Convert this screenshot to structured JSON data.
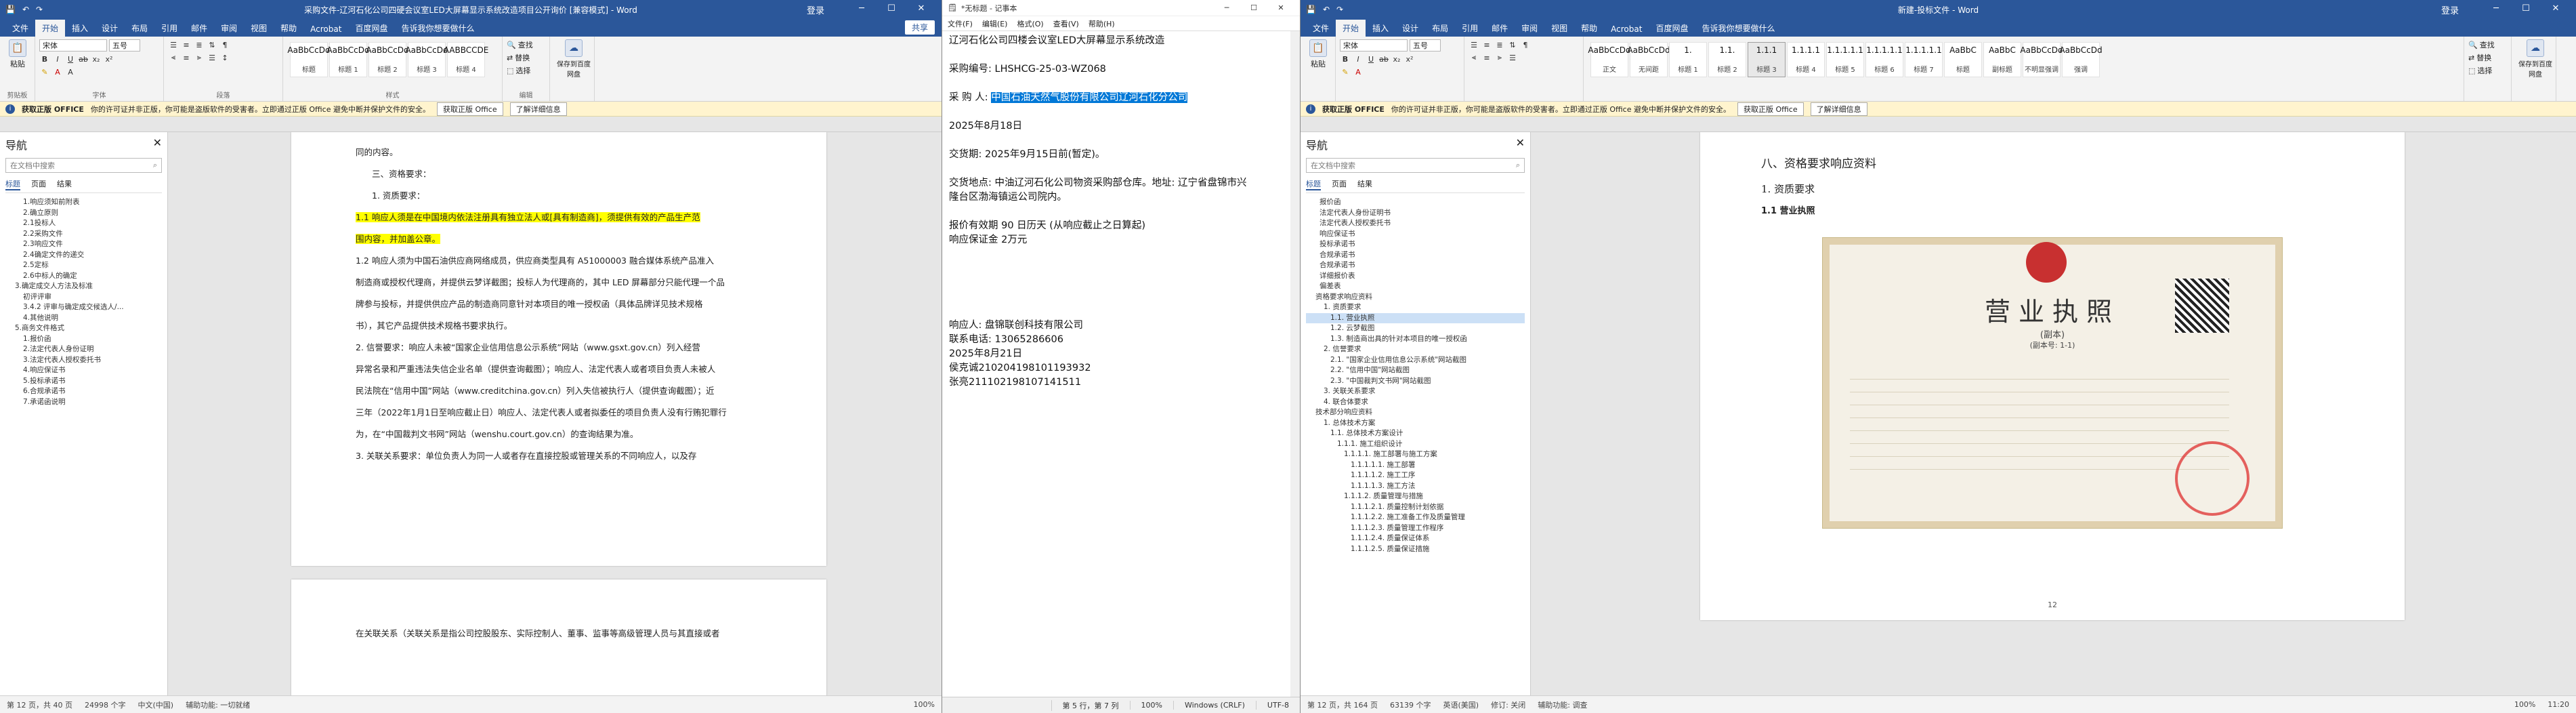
{
  "win1": {
    "title": "采购文件-辽河石化公司四硬会议室LED大屏幕显示系统改造项目公开询价 [兼容模式] - Word",
    "login": "登录",
    "tabs": [
      "文件",
      "开始",
      "插入",
      "设计",
      "布局",
      "引用",
      "邮件",
      "审阅",
      "视图",
      "帮助",
      "Acrobat",
      "百度网盘"
    ],
    "tell": "告诉我你想要做什么",
    "share": "共享",
    "font": "宋体",
    "size": "五号",
    "paste": "粘贴",
    "styles": [
      {
        "p": "AaBbCcDd",
        "n": "标题"
      },
      {
        "p": "AaBbCcDd",
        "n": "标题 1"
      },
      {
        "p": "AaBbCcDd",
        "n": "标题 2"
      },
      {
        "p": "AaBbCcDd",
        "n": "标题 3"
      },
      {
        "p": "AABBCCDE",
        "n": "标题 4"
      }
    ],
    "edit": [
      "查找",
      "替换",
      "选择"
    ],
    "save_label": "保存到百度网盘",
    "groups": [
      "剪贴板",
      "字体",
      "段落",
      "样式",
      "编辑",
      "保存"
    ],
    "warn": "获取正版 OFFICE",
    "warn_text": "你的许可证并非正版，你可能是盗版软件的受害者。立即通过正版 Office 避免中断并保护文件的安全。",
    "warn_btn1": "获取正版 Office",
    "warn_btn2": "了解详细信息",
    "nav_title": "导航",
    "nav_search": "在文档中搜索",
    "nav_tabs": [
      "标题",
      "页面",
      "结果"
    ],
    "nav_items": [
      "1.响应须知前附表",
      "2.确立原则",
      "2.1投标人",
      "2.2采购文件",
      "2.3响应文件",
      "2.4确定文件的递交",
      "2.5定标",
      "2.6中标人的确定",
      "3.确定成交人方法及标准",
      "初评评审",
      "3.4.2 评审与确定成交候选人/...",
      "4.其他说明",
      "5.商务文件格式",
      "1.报价函",
      "2.法定代表人身份证明",
      "3.法定代表人授权委托书",
      "4.响应保证书",
      "5.投标承诺书",
      "6.合规承诺书",
      "7.承诺函说明"
    ],
    "page": [
      "同的内容。",
      "三、资格要求：",
      "1. 资质要求：",
      "1.1 响应人须是在中国境内依法注册具有独立法人或[具有制造商]，须提供有效的产品生产范",
      "围内容，并加盖公章。",
      "1.2 响应人须为中国石油供应商网络成员，供应商类型具有 A51000003 融合媒体系统产品准入",
      "制造商或授权代理商，并提供云梦详截图；投标人为代理商的，其中 LED 屏幕部分只能代理一个品",
      "牌参与投标，并提供供应产品的制造商同意针对本项目的唯一授权函（具体品牌详见技术规格",
      "书），其它产品提供技术规格书要求执行。",
      "2. 信誉要求：响应人未被“国家企业信用信息公示系统”网站（www.gsxt.gov.cn）列入经营",
      "异常名录和严重违法失信企业名单（提供查询截图）；响应人、法定代表人或者项目负责人未被人",
      "民法院在“信用中国”网站（www.creditchina.gov.cn）列入失信被执行人（提供查询截图）；近",
      "三年（2022年1月1日至响应截止日）响应人、法定代表人或者拟委任的项目负责人没有行贿犯罪行",
      "为，在“中国裁判文书网”网站（wenshu.court.gov.cn）的查询结果为准。",
      "3. 关联关系要求：单位负责人为同一人或者存在直接控股或管理关系的不同响应人，以及存"
    ],
    "page2": "在关联关系（关联关系是指公司控股股东、实际控制人、董事、监事等高级管理人员与其直接或者",
    "status": [
      "第 12 页，共 40 页",
      "24998 个字",
      "中文(中国)",
      "辅助功能: 一切就绪"
    ],
    "zoom": "100%"
  },
  "notepad": {
    "title": "*无标题 - 记事本",
    "menu": [
      "文件(F)",
      "编辑(E)",
      "格式(O)",
      "查看(V)",
      "帮助(H)"
    ],
    "lines": [
      "辽河石化公司四楼会议室LED大屏幕显示系统改造",
      "",
      "采购编号: LHSHCG-25-03-WZ068",
      "",
      "采 购 人: 中国石油天然气股份有限公司辽河石化分公司",
      "",
      "2025年8月18日",
      "",
      "交货期: 2025年9月15日前(暂定)。",
      "",
      "交货地点: 中油辽河石化公司物资采购部仓库。地址: 辽宁省盘锦市兴",
      "隆台区渤海镇运公司院内。",
      "",
      "报价有效期          90  日历天 (从响应截止之日算起)",
      "响应保证金                  2万元",
      "",
      "",
      "",
      "",
      "",
      "响应人: 盘锦联创科技有限公司",
      "联系电话: 13065286606",
      "2025年8月21日",
      "侯克诚210204198101193932",
      "张亮211102198107141511"
    ],
    "highlight": "中国石油天然气股份有限公司辽河石化分公司",
    "status": [
      "第 5 行，第 7 列",
      "100%",
      "Windows (CRLF)",
      "UTF-8"
    ]
  },
  "win2": {
    "title": "新建-投标文件 - Word",
    "login": "登录",
    "tabs": [
      "文件",
      "开始",
      "插入",
      "设计",
      "布局",
      "引用",
      "邮件",
      "审阅",
      "视图",
      "帮助",
      "Acrobat",
      "百度网盘"
    ],
    "tell": "告诉我你想要做什么",
    "font": "宋体",
    "size": "五号",
    "paste": "粘贴",
    "styles": [
      {
        "p": "AaBbCcDd",
        "n": "正文"
      },
      {
        "p": "AaBbCcDd",
        "n": "无间距"
      },
      {
        "p": "1.",
        "n": "标题 1"
      },
      {
        "p": "1.1.",
        "n": "标题 2"
      },
      {
        "p": "1.1.1",
        "n": "标题 3"
      },
      {
        "p": "1.1.1.1",
        "n": "标题 4"
      },
      {
        "p": "1.1.1.1.1",
        "n": "标题 5"
      },
      {
        "p": "1.1.1.1.1",
        "n": "标题 6"
      },
      {
        "p": "1.1.1.1.1",
        "n": "标题 7"
      },
      {
        "p": "AaBbC",
        "n": "标题"
      },
      {
        "p": "AaBbC",
        "n": "副标题"
      },
      {
        "p": "AaBbCcDd",
        "n": "不明显强调"
      },
      {
        "p": "AaBbCcDd",
        "n": "强调"
      }
    ],
    "edit": [
      "查找",
      "替换",
      "选择"
    ],
    "save_label": "保存到百度网盘",
    "nav_title": "导航",
    "nav_search": "在文档中搜索",
    "nav_tabs": [
      "标题",
      "页面",
      "结果"
    ],
    "nav_items": [
      "报价函",
      "法定代表人身份证明书",
      "法定代表人授权委托书",
      "响应保证书",
      "投标承诺书",
      "合规承诺书",
      "合规承诺书",
      "详细报价表",
      "偏差表",
      "资格要求响应资料",
      "1. 资质要求",
      "1.1. 营业执照",
      "1.2. 云梦截图",
      "1.3. 制造商出具的针对本项目的唯一授权函",
      "2. 信誉要求",
      "2.1. \"国家企业信用信息公示系统\"网站截图",
      "2.2. \"信用中国\"网站截图",
      "2.3. \"中国裁判文书网\"网站截图",
      "3. 关联关系要求",
      "4. 联合体要求",
      "技术部分响应资料",
      "1. 总体技术方案",
      "1.1. 总体技术方案设计",
      "1.1.1. 施工组织设计",
      "1.1.1.1. 施工部署与施工方案",
      "1.1.1.1.1. 施工部署",
      "1.1.1.1.2. 施工工序",
      "1.1.1.1.3. 施工方法",
      "1.1.1.2. 质量管理与措施",
      "1.1.1.2.1. 质量控制计划依据",
      "1.1.1.2.2. 施工准备工作及质量管理",
      "1.1.1.2.3. 质量管理工作程序",
      "1.1.1.2.4. 质量保证体系",
      "1.1.1.2.5. 质量保证措施"
    ],
    "page_h1": "八、资格要求响应资料",
    "page_h2": "1. 资质要求",
    "page_h3": "1.1 营业执照",
    "license_title": "营业执照",
    "license_sub": "(副本)",
    "license_note": "(副本号: 1-1)",
    "page_num": "12",
    "status": [
      "第 12 页，共 164 页",
      "63139 个字",
      "英语(美国)",
      "修订: 关闭",
      "辅助功能: 调查"
    ],
    "zoom": "100%"
  },
  "taskbar_time": "11:20"
}
